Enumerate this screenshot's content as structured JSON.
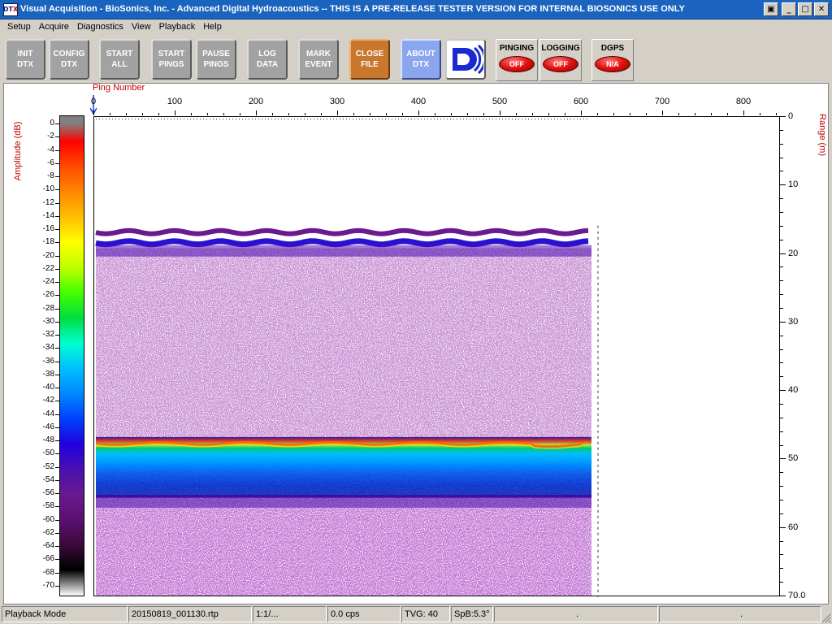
{
  "window": {
    "title": "Visual Acquisition  -  BioSonics, Inc.  -  Advanced Digital Hydroacoustics  -- THIS IS A PRE-RELEASE TESTER VERSION FOR INTERNAL BIOSONICS USE ONLY",
    "icon_text": "DT",
    "icon_sub": "X",
    "controls": {
      "restore": "▣",
      "minimize": "_",
      "maximize": "□",
      "close": "✕"
    }
  },
  "menu": [
    "Setup",
    "Acquire",
    "Diagnostics",
    "View",
    "Playback",
    "Help"
  ],
  "toolbar": {
    "buttons": [
      {
        "id": "init",
        "line1": "INIT",
        "line2": "DTX"
      },
      {
        "id": "config",
        "line1": "CONFIG",
        "line2": "DTX"
      },
      {
        "id": "start-all",
        "line1": "START",
        "line2": "ALL"
      },
      {
        "id": "start-pings",
        "line1": "START",
        "line2": "PINGS"
      },
      {
        "id": "pause-pings",
        "line1": "PAUSE",
        "line2": "PINGS"
      },
      {
        "id": "log-data",
        "line1": "LOG",
        "line2": "DATA"
      },
      {
        "id": "mark-event",
        "line1": "MARK",
        "line2": "EVENT"
      },
      {
        "id": "close-file",
        "line1": "CLOSE",
        "line2": "FILE"
      },
      {
        "id": "about-dtx",
        "line1": "ABOUT",
        "line2": "DTX"
      }
    ],
    "status": [
      {
        "label": "PINGING",
        "value": "OFF"
      },
      {
        "label": "LOGGING",
        "value": "OFF"
      },
      {
        "label": "DGPS",
        "value": "N/A"
      }
    ]
  },
  "echogram": {
    "x_title": "Ping Number",
    "y_title": "Range (m)",
    "amp_title": "Amplitude (dB)",
    "x_ticks": [
      "0",
      "100",
      "200",
      "300",
      "400",
      "500",
      "600",
      "700",
      "800"
    ],
    "y_ticks": [
      "0",
      "10",
      "20",
      "30",
      "40",
      "50",
      "60",
      "70.0"
    ],
    "amp_ticks": [
      "0",
      "-2",
      "-4",
      "-6",
      "-8",
      "-10",
      "-12",
      "-14",
      "-16",
      "-18",
      "-20",
      "-22",
      "-24",
      "-26",
      "-28",
      "-30",
      "-32",
      "-34",
      "-36",
      "-38",
      "-40",
      "-42",
      "-44",
      "-46",
      "-48",
      "-50",
      "-52",
      "-54",
      "-56",
      "-58",
      "-60",
      "-62",
      "-64",
      "-66",
      "-68",
      "-70"
    ],
    "pings_recorded": 610,
    "x_max": 845,
    "range_max_m": 70,
    "layers": {
      "surface_band_m": 17.5,
      "bottom_m": 47.6
    },
    "colormap": [
      "#808080",
      "#ff0000",
      "#ff4a00",
      "#ff8800",
      "#ffc000",
      "#ffff00",
      "#bfff00",
      "#44ff00",
      "#00dd40",
      "#00ffd0",
      "#00c0ff",
      "#0088ff",
      "#0040ff",
      "#2000e0",
      "#4a10b0",
      "#6a1a90",
      "#5a1070",
      "#3a0a3a",
      "#000000",
      "#ffffff"
    ]
  },
  "statusbar": {
    "mode": "Playback Mode",
    "file": "20150819_001130.rtp",
    "ratio": "1:1/...",
    "cps": "0.0 cps",
    "tvg": "TVG: 40",
    "spb": "SpB:5.3°",
    "dot1": ".",
    "dot2": "."
  }
}
